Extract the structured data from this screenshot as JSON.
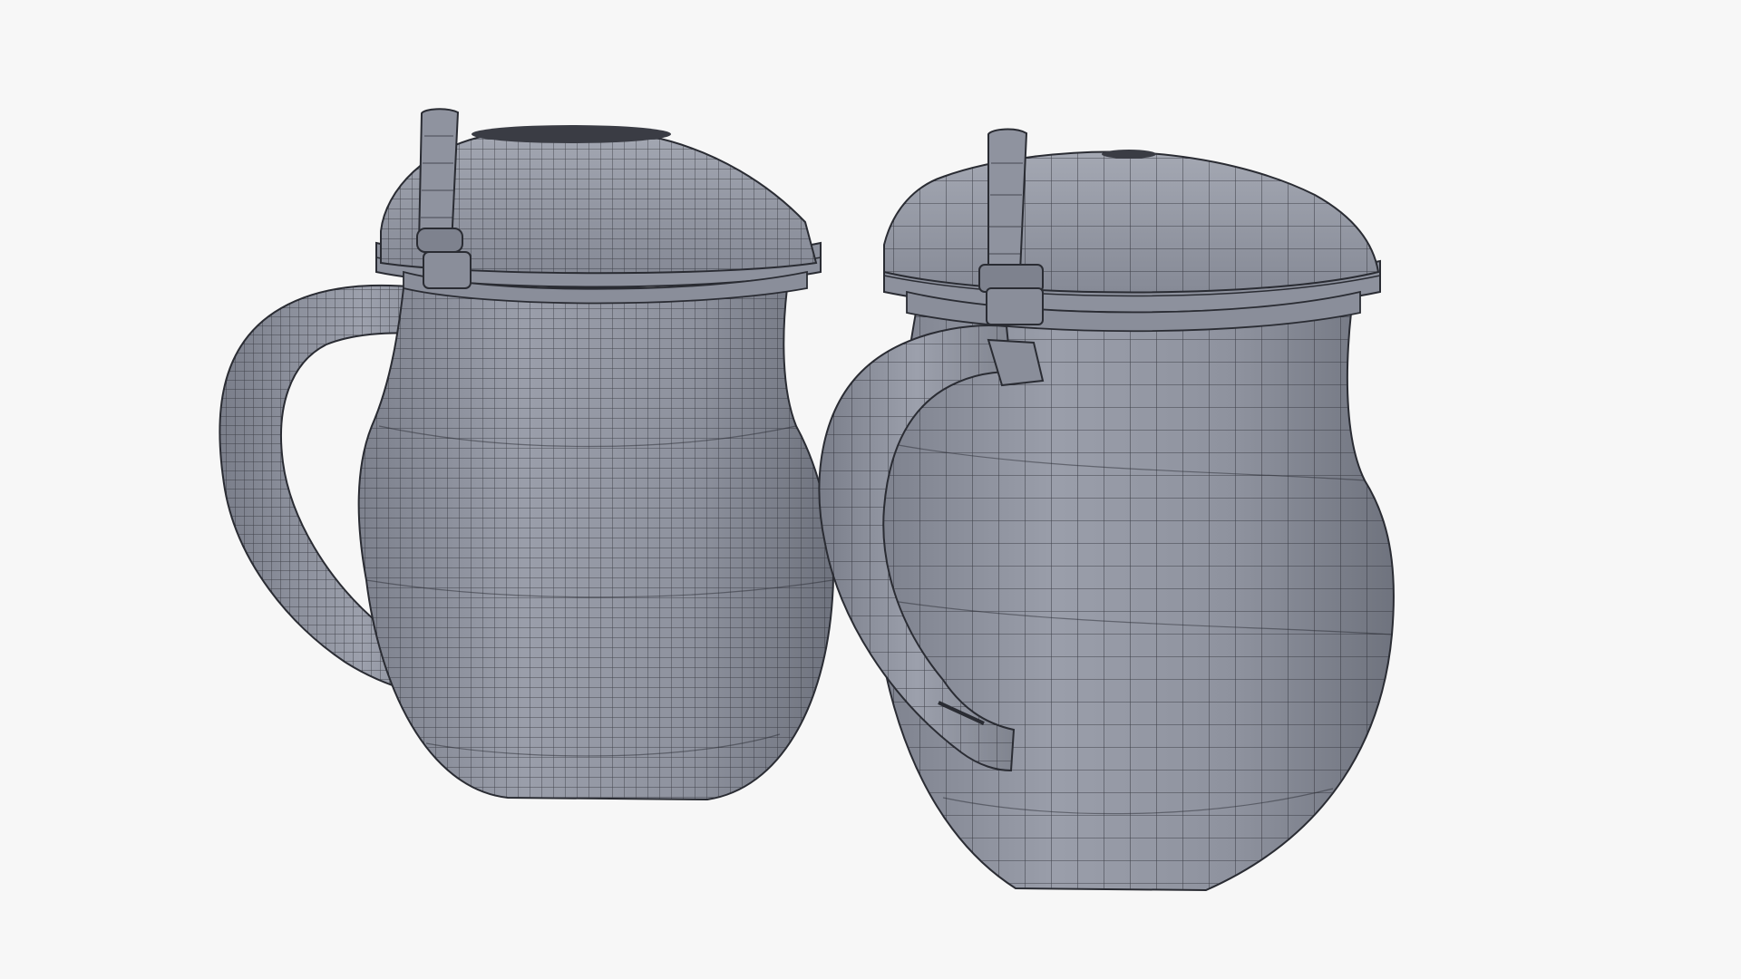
{
  "scene": {
    "background_color": "#f7f7f7",
    "mesh_fill_color": "#8e929f",
    "wire_color": "#2a2c33",
    "objects": [
      {
        "name": "wireframe-tankard-dense",
        "density": "high"
      },
      {
        "name": "wireframe-tankard-sparse",
        "density": "low"
      }
    ]
  }
}
